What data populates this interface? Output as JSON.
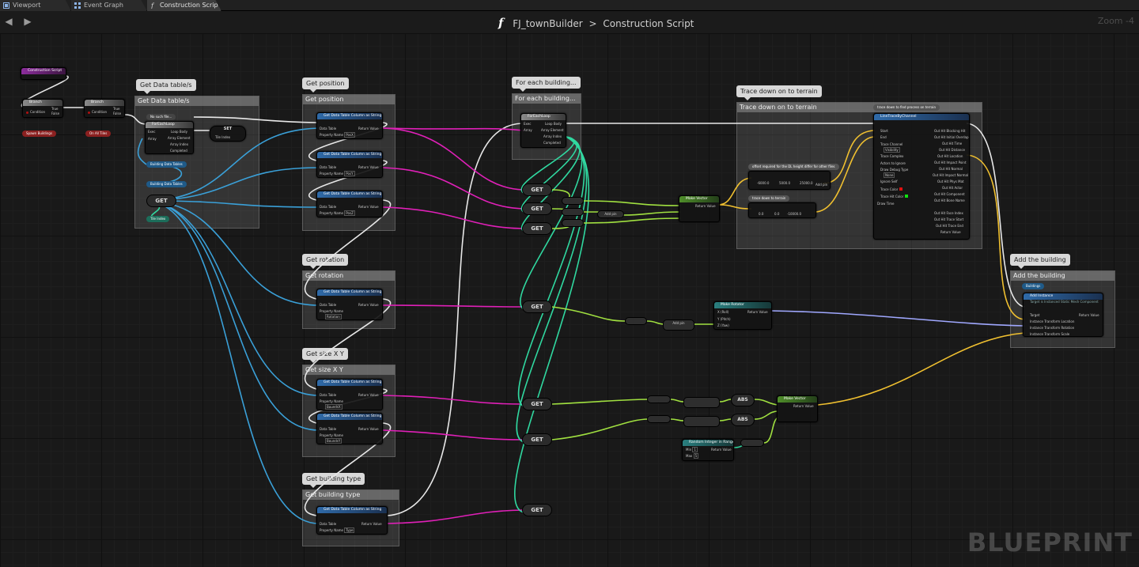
{
  "tabs": [
    {
      "label": "Viewport"
    },
    {
      "label": "Event Graph"
    },
    {
      "label": "Construction Scrip"
    }
  ],
  "breadcrumb": {
    "function_glyph": "f",
    "blueprint": "FJ_townBuilder",
    "separator": ">",
    "graph": "Construction Script"
  },
  "zoom": "Zoom -4",
  "watermark": "BLUEPRINT",
  "comments": {
    "get_tables": {
      "bubble": "Get Data table/s",
      "title": "Get Data table/s"
    },
    "get_position": {
      "bubble": "Get position",
      "title": "Get position"
    },
    "get_rotation": {
      "bubble": "Get rotation",
      "title": "Get rotation"
    },
    "get_size": {
      "bubble": "Get size X Y",
      "title": "Get size X Y"
    },
    "get_type": {
      "bubble": "Get building type",
      "title": "Get building type"
    },
    "for_each": {
      "bubble": "For each building...",
      "title": "For each building..."
    },
    "trace": {
      "bubble": "Trace down on to terrain",
      "title": "Trace down on to terrain"
    },
    "add": {
      "bubble": "Add the building",
      "title": "Add the building"
    }
  },
  "nodes": {
    "construction_script": "Construction Script",
    "branch": "Branch",
    "branch_true": "True",
    "branch_false": "False",
    "condition": "Condition",
    "spawn_buildings": "Spawn Buildings",
    "on_all_tiles": "On All Tiles",
    "for_each_loop": "ForEachLoop",
    "exec": "Exec",
    "array": "Array",
    "loop_body": "Loop Body",
    "array_element": "Array Element",
    "array_index": "Array Index",
    "completed": "Completed",
    "set": "SET",
    "tile_index": "Tile Index",
    "building_data_tables": "Building Data Tables",
    "get": "GET",
    "no_such_file": "No such file...",
    "get_data_table_column": "Get Data Table Column as String",
    "data_table": "Data Table",
    "property_name": "Property Name",
    "return_value": "Return Value",
    "pos_x": "PosX",
    "pos_y": "PosY",
    "pos_z": "PosZ",
    "rotation": "Rotation",
    "size_x": "BoundsX",
    "size_y": "BoundsY",
    "type": "Type",
    "make_vector": "Make Vector",
    "make_rotator": "Make Rotator",
    "roll": "X (Roll)",
    "pitch": "Y (Pitch)",
    "yaw": "Z (Yaw)",
    "add_pin": "Add pin",
    "abs": "ABS",
    "random_integer": "Random Integer in Range",
    "min": "Min",
    "max": "Max",
    "line_trace": "LineTraceByChannel",
    "start": "Start",
    "end": "End",
    "trace_channel": "Trace Channel",
    "visibility": "Visibility",
    "trace_complex": "Trace Complex",
    "actors_to_ignore": "Actors to Ignore",
    "draw_debug_type": "Draw Debug Type",
    "none": "None",
    "ignore_self": "Ignore Self",
    "trace_color": "Trace Color",
    "trace_hit_color": "Trace Hit Color",
    "draw_time": "Draw Time",
    "out_blocking_hit": "Out Hit Blocking Hit",
    "out_initial_overlap": "Out Hit Initial Overlap",
    "out_time": "Out Hit Time",
    "out_distance": "Out Hit Distance",
    "out_location": "Out Hit Location",
    "out_impact_point": "Out Hit Impact Point",
    "out_normal": "Out Hit Normal",
    "out_impact_normal": "Out Hit Impact Normal",
    "out_phys_mat": "Out Hit Phys Mat",
    "out_actor": "Out Hit Actor",
    "out_component": "Out Hit Component",
    "out_bone_name": "Out Hit Bone Name",
    "out_face_index": "Out Hit Face Index",
    "out_trace_start": "Out Hit Trace Start",
    "out_trace_end": "Out Hit Trace End",
    "trace_note": "trace down to find process on terrain",
    "offset_note": "offset required for the DL height differ for other files",
    "trace_down_note": "trace down to terrain",
    "vec_a": [
      "-6000.0",
      "5000.0",
      "25000.0"
    ],
    "vec_b": [
      "0.0",
      "0.0",
      "-10000.0"
    ],
    "buildings_var": "Buildings",
    "add_instance": "Add Instance",
    "add_instance_sub": "Target is Instanced Static Mesh Component",
    "target": "Target",
    "instance_location": "Instance Transform Location",
    "instance_rotation": "Instance Transform Rotation",
    "instance_scale": "Instance Transform Scale",
    "const_1": "1",
    "const_5": "5"
  },
  "colors": {
    "exec_wire": "#e8e8e8",
    "string_wire": "#e020b8",
    "table_wire": "#3aa0d8",
    "vector_wire": "#f0c030",
    "float_wire": "#a0e040",
    "int_wire": "#30d8a0",
    "rotator_wire": "#a0a8ff"
  }
}
